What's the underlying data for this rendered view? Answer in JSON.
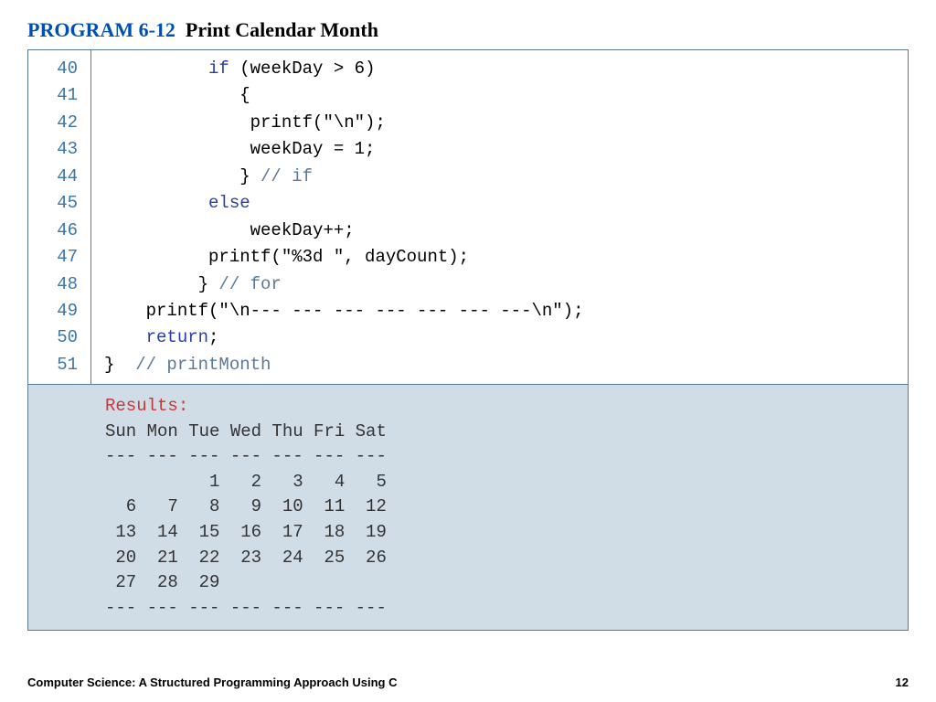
{
  "title": {
    "program_num": "PROGRAM 6-12",
    "program_name": "Print Calendar Month"
  },
  "code": {
    "line_numbers": [
      "40",
      "41",
      "42",
      "43",
      "44",
      "45",
      "46",
      "47",
      "48",
      "49",
      "50",
      "51"
    ],
    "lines": [
      {
        "indent": "          ",
        "kw": "if",
        "rest": " (weekDay > 6)"
      },
      {
        "indent": "             ",
        "rest": "{"
      },
      {
        "indent": "              ",
        "rest": "printf(\"\\n\");"
      },
      {
        "indent": "              ",
        "rest": "weekDay = 1;"
      },
      {
        "indent": "             ",
        "rest": "} ",
        "com": "// if"
      },
      {
        "indent": "          ",
        "kw": "else",
        "rest": ""
      },
      {
        "indent": "              ",
        "rest": "weekDay++;"
      },
      {
        "indent": "          ",
        "rest": "printf(\"%3d \", dayCount);"
      },
      {
        "indent": "         ",
        "rest": "} ",
        "com": "// for"
      },
      {
        "indent": "    ",
        "rest": "printf(\"\\n--- --- --- --- --- --- ---\\n\");"
      },
      {
        "indent": "    ",
        "kw": "return",
        "rest": ";"
      },
      {
        "indent": "",
        "rest": "}  ",
        "com": "// printMonth"
      }
    ]
  },
  "results": {
    "label": "Results:",
    "output": "Sun Mon Tue Wed Thu Fri Sat\n--- --- --- --- --- --- ---\n          1   2   3   4   5\n  6   7   8   9  10  11  12\n 13  14  15  16  17  18  19\n 20  21  22  23  24  25  26\n 27  28  29\n--- --- --- --- --- --- ---"
  },
  "footer": {
    "book": "Computer Science: A Structured Programming Approach Using C",
    "page": "12"
  }
}
